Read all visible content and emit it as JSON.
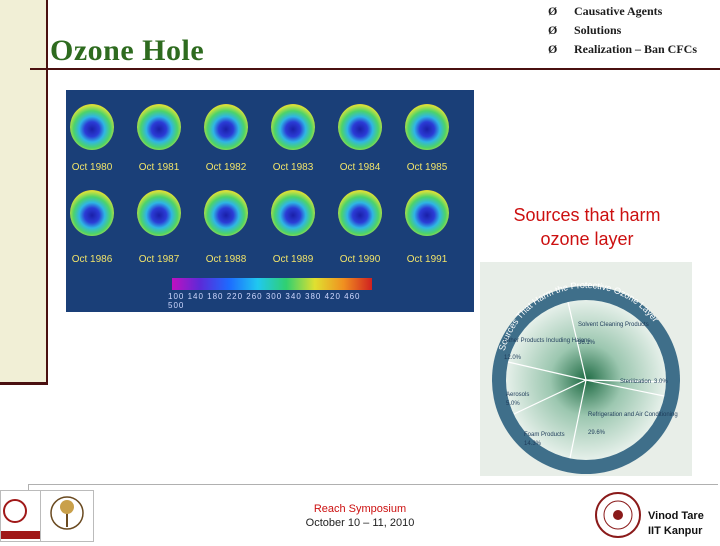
{
  "slide": {
    "title": "Ozone Hole",
    "bullets": [
      {
        "arrow": "Ø",
        "text": "Causative Agents"
      },
      {
        "arrow": "Ø",
        "text": "Solutions"
      },
      {
        "arrow": "Ø",
        "text": "Realization – Ban CFCs"
      }
    ],
    "sources_heading": "Sources that harm ozone layer"
  },
  "ozone_images": {
    "labels": [
      "Oct 1980",
      "Oct 1981",
      "Oct 1982",
      "Oct 1983",
      "Oct 1984",
      "Oct 1985",
      "Oct 1986",
      "Oct 1987",
      "Oct 1988",
      "Oct 1989",
      "Oct 1990",
      "Oct 1991"
    ],
    "scale_ticks": "100 140 180 220 260 300 340 380 420 460 500"
  },
  "pie_chart": {
    "arc_title": "Sources That Harm the Protective Ozone Layer",
    "slices": [
      {
        "label": "Solvent Cleaning Products",
        "value": "36.1%"
      },
      {
        "label": "Sterilization",
        "value": "3.0%"
      },
      {
        "label": "Refrigeration and Air Conditioning",
        "value": "29.6%"
      },
      {
        "label": "Foam Products",
        "value": "14.3%"
      },
      {
        "label": "Aerosols",
        "value": "5.0%"
      },
      {
        "label": "Other Products Including Halons",
        "value": "12.0%"
      }
    ]
  },
  "footer": {
    "event": "Reach Symposium",
    "dates": "October 10 – 11, 2010",
    "presenter_name": "Vinod Tare",
    "presenter_org": "IIT Kanpur"
  }
}
